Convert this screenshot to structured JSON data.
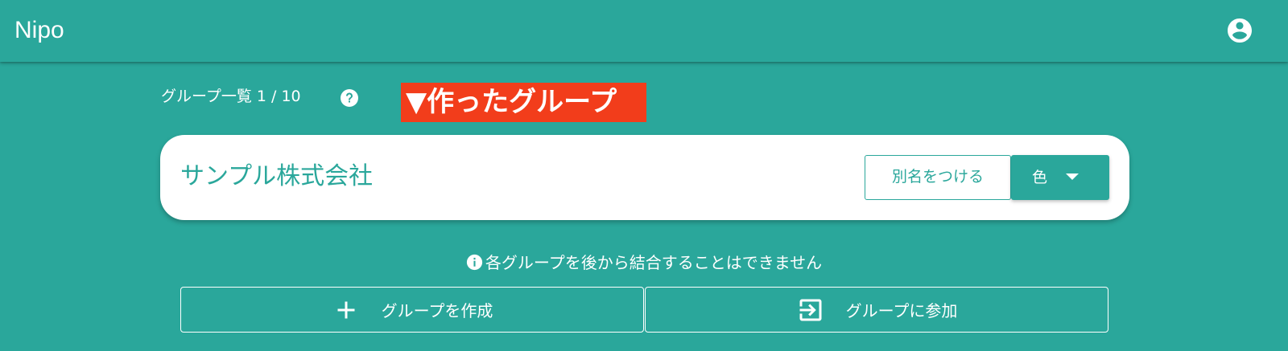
{
  "app_bar": {
    "title": "Nipo",
    "account_icon": "account-circle-icon"
  },
  "group_list": {
    "count_label": "グループ一覧 1 / 10",
    "help_icon": "help-circle-icon"
  },
  "annotation": {
    "text": "▼作ったグループ",
    "color": "#f23d1b"
  },
  "group_card": {
    "name": "サンプル株式会社",
    "alias_button_label": "別名をつける",
    "color_button_label": "色",
    "color_button_icon": "caret-down-icon"
  },
  "notice": {
    "icon": "info-icon",
    "text": "各グループを後から結合することはできません"
  },
  "actions": {
    "create_label": "グループを作成",
    "create_icon": "plus-icon",
    "join_label": "グループに参加",
    "join_icon": "login-icon"
  },
  "colors": {
    "primary": "#2aa79b",
    "on_primary": "#ffffff",
    "surface": "#ffffff"
  }
}
